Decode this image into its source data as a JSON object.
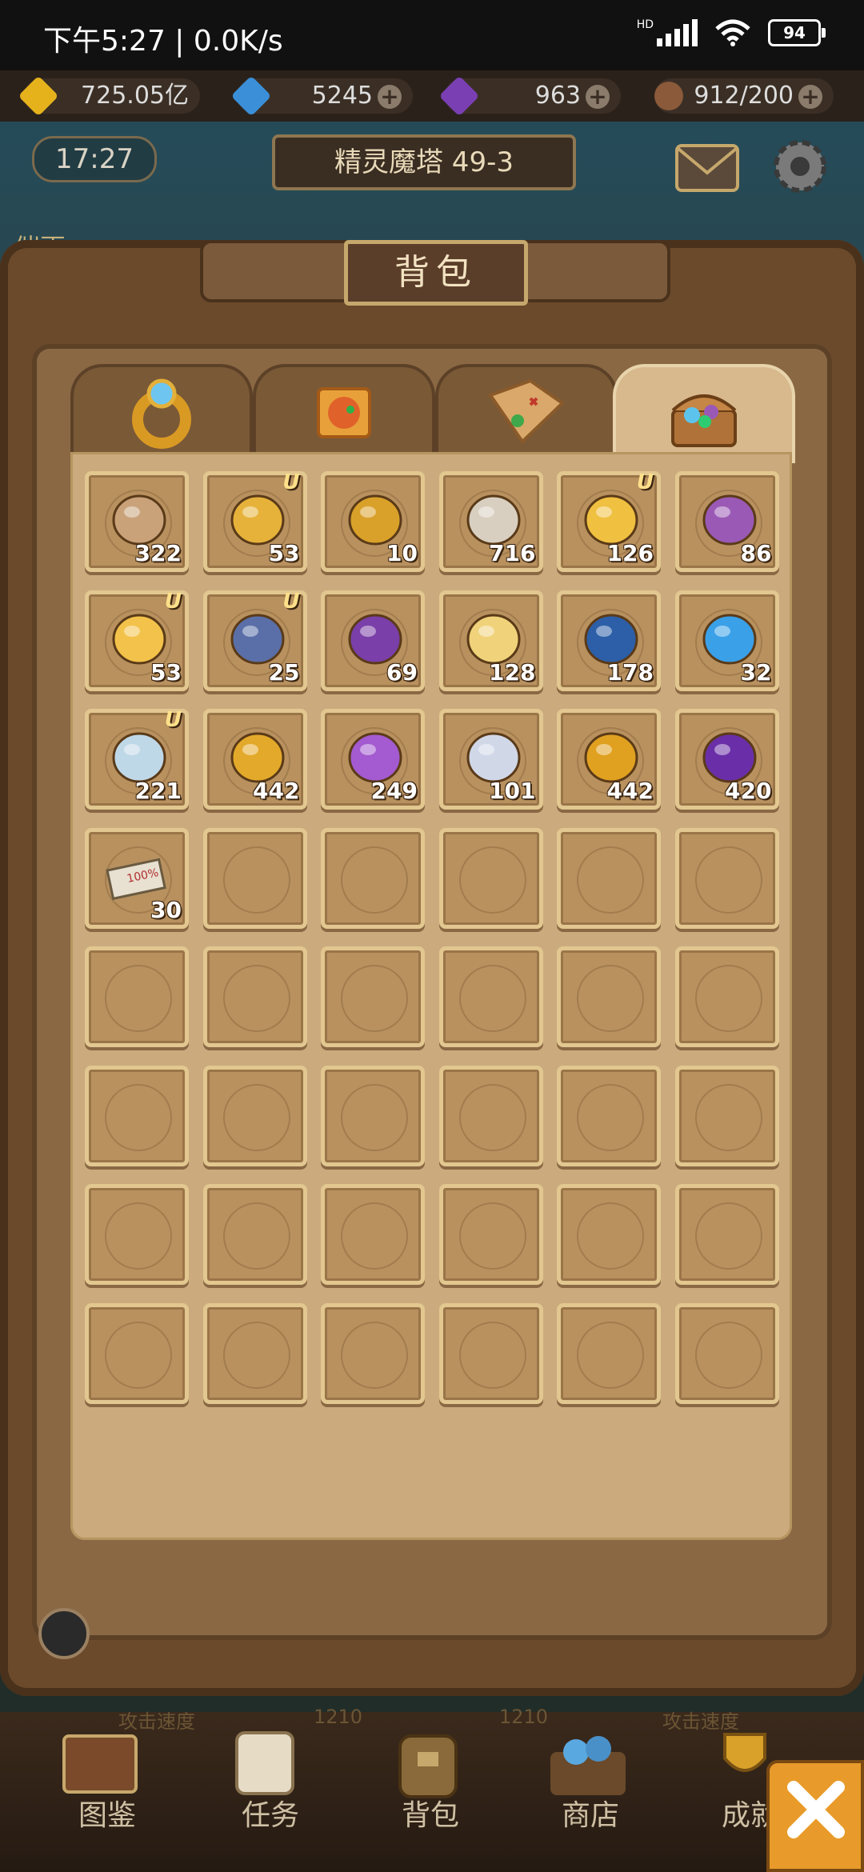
{
  "status_bar": {
    "time": "下午5:27 | 0.0K/s",
    "network": "HD",
    "battery": "94"
  },
  "currency_bar": {
    "gold": "725.05亿",
    "blue_gem": "5245",
    "purple_gem": "963",
    "stamina": "912/200"
  },
  "top": {
    "clock": "17:27",
    "stage": "精灵魔塔 49-3",
    "hint": "催更……"
  },
  "panel": {
    "title": "背包",
    "tabs": [
      {
        "icon": "ring-icon"
      },
      {
        "icon": "puzzle-piece-icon"
      },
      {
        "icon": "treasure-map-icon"
      },
      {
        "icon": "treasure-chest-icon"
      }
    ]
  },
  "inventory": {
    "items": [
      {
        "icon": "shirt-token-icon",
        "count": "322",
        "u": false
      },
      {
        "icon": "hourglass-icon",
        "count": "53",
        "u": true
      },
      {
        "icon": "gold-badge-icon",
        "count": "10",
        "u": false
      },
      {
        "icon": "scroll-key-icon",
        "count": "716",
        "u": false
      },
      {
        "icon": "gold-ore-icon",
        "count": "126",
        "u": true
      },
      {
        "icon": "rainbow-crystal-icon",
        "count": "86",
        "u": false
      },
      {
        "icon": "winged-gem-icon",
        "count": "53",
        "u": true
      },
      {
        "icon": "blue-chest-icon",
        "count": "25",
        "u": true
      },
      {
        "icon": "flame-claw-icon",
        "count": "69",
        "u": false
      },
      {
        "icon": "eye-orb-icon",
        "count": "128",
        "u": false
      },
      {
        "icon": "blue-book-icon",
        "count": "178",
        "u": false
      },
      {
        "icon": "blue-flame-orb-icon",
        "count": "32",
        "u": false
      },
      {
        "icon": "ice-crystal-icon",
        "count": "221",
        "u": true
      },
      {
        "icon": "gold-star-icon",
        "count": "442",
        "u": false
      },
      {
        "icon": "purple-book-icon",
        "count": "249",
        "u": false
      },
      {
        "icon": "feather-sword-icon",
        "count": "101",
        "u": false
      },
      {
        "icon": "gold-fire-icon",
        "count": "442",
        "u": false
      },
      {
        "icon": "purple-fire-icon",
        "count": "420",
        "u": false
      },
      {
        "icon": "coupon-100-icon",
        "count": "30",
        "u": false,
        "ticket_text": "100%"
      }
    ],
    "total_slots": 48
  },
  "bottom_stats": {
    "left_label": "攻击速度",
    "value1": "1210",
    "value2": "1210",
    "right_label": "攻击速度"
  },
  "nav": {
    "items": [
      "图鉴",
      "任务",
      "背包",
      "商店",
      "成就"
    ]
  },
  "colors": {
    "panel": "#6b4a2b",
    "grid_bg": "#cbab7d",
    "cell_border": "#e2c890",
    "close_button": "#e89b2a"
  }
}
